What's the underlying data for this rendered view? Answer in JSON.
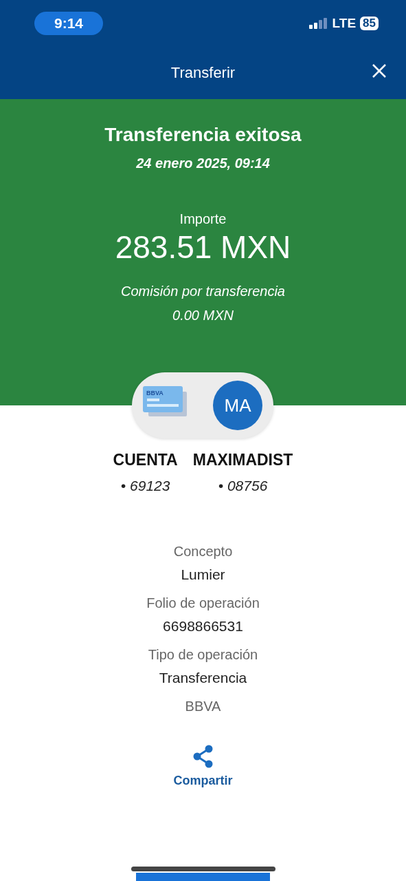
{
  "status_bar": {
    "time": "9:14",
    "network": "LTE",
    "battery": "85"
  },
  "header": {
    "title": "Transferir"
  },
  "result": {
    "title": "Transferencia exitosa",
    "date": "24 enero 2025, 09:14",
    "amount_label": "Importe",
    "amount": "283.51 MXN",
    "fee_label": "Comisión por transferencia",
    "fee": "0.00 MXN"
  },
  "parties": {
    "card_label": "BBVA",
    "avatar_initials": "MA",
    "accounts": [
      {
        "name": "CUENTA",
        "number": "• 69123"
      },
      {
        "name": "MAXIMADIST",
        "number": "• 08756"
      }
    ]
  },
  "details": [
    {
      "label": "Concepto",
      "value": "Lumier"
    },
    {
      "label": "Folio de operación",
      "value": "6698866531"
    },
    {
      "label": "Tipo de operación",
      "value": "Transferencia"
    },
    {
      "label": "BBVA"
    }
  ],
  "share": {
    "label": "Compartir"
  }
}
